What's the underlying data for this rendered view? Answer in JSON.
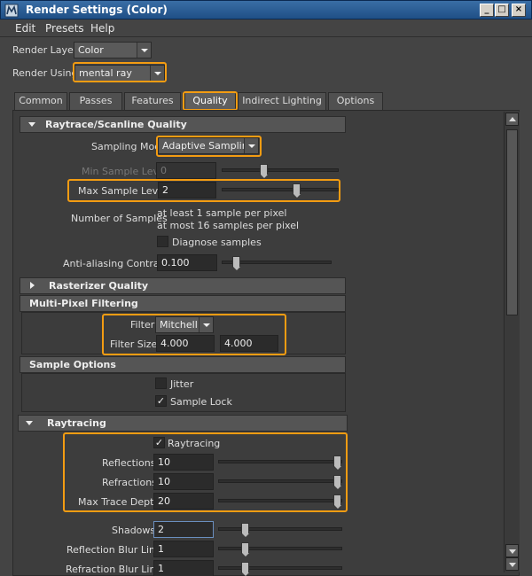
{
  "window": {
    "title": "Render Settings (Color)"
  },
  "menu": [
    "Edit",
    "Presets",
    "Help"
  ],
  "render_layer": {
    "label": "Render Layer",
    "value": "Color"
  },
  "render_using": {
    "label": "Render Using",
    "value": "mental ray"
  },
  "tabs": [
    "Common",
    "Passes",
    "Features",
    "Quality",
    "Indirect Lighting",
    "Options"
  ],
  "active_tab": "Quality",
  "raytrace_scanline": {
    "header": "Raytrace/Scanline Quality",
    "sampling_mode_label": "Sampling Mode",
    "sampling_mode": "Adaptive Sampling",
    "min_label": "Min Sample Level",
    "min_value": "0",
    "min_level": 0.35,
    "max_label": "Max Sample Level",
    "max_value": "2",
    "max_level": 0.65,
    "num_samples_label": "Number of Samples",
    "num_samples_line1": "at least 1 sample per pixel",
    "num_samples_line2": "at most 16 samples per pixel",
    "diagnose_label": "Diagnose samples",
    "aa_label": "Anti-aliasing Contrast",
    "aa_value": "0.100",
    "aa_level": 0.1
  },
  "rasterizer": {
    "header": "Rasterizer Quality"
  },
  "multipixel": {
    "header": "Multi-Pixel Filtering",
    "filter_label": "Filter",
    "filter_value": "Mitchell",
    "size_label": "Filter Size",
    "size_x": "4.000",
    "size_y": "4.000"
  },
  "sample_options": {
    "header": "Sample Options",
    "jitter_label": "Jitter",
    "sample_lock_label": "Sample Lock",
    "sample_lock_check": "✓"
  },
  "raytracing": {
    "header": "Raytracing",
    "raytracing_label": "Raytracing",
    "raytracing_check": "✓",
    "reflections_label": "Reflections",
    "reflections_value": "10",
    "refractions_label": "Refractions",
    "refractions_value": "10",
    "max_depth_label": "Max Trace Depth",
    "max_depth_value": "20",
    "shadows_label": "Shadows",
    "shadows_value": "2",
    "refl_blur_label": "Reflection Blur Limit",
    "refl_blur_value": "1",
    "refr_blur_label": "Refraction Blur Limit",
    "refr_blur_value": "1"
  },
  "colors": {
    "highlight": "#f39c12",
    "titlebar": "#2f5f98"
  }
}
